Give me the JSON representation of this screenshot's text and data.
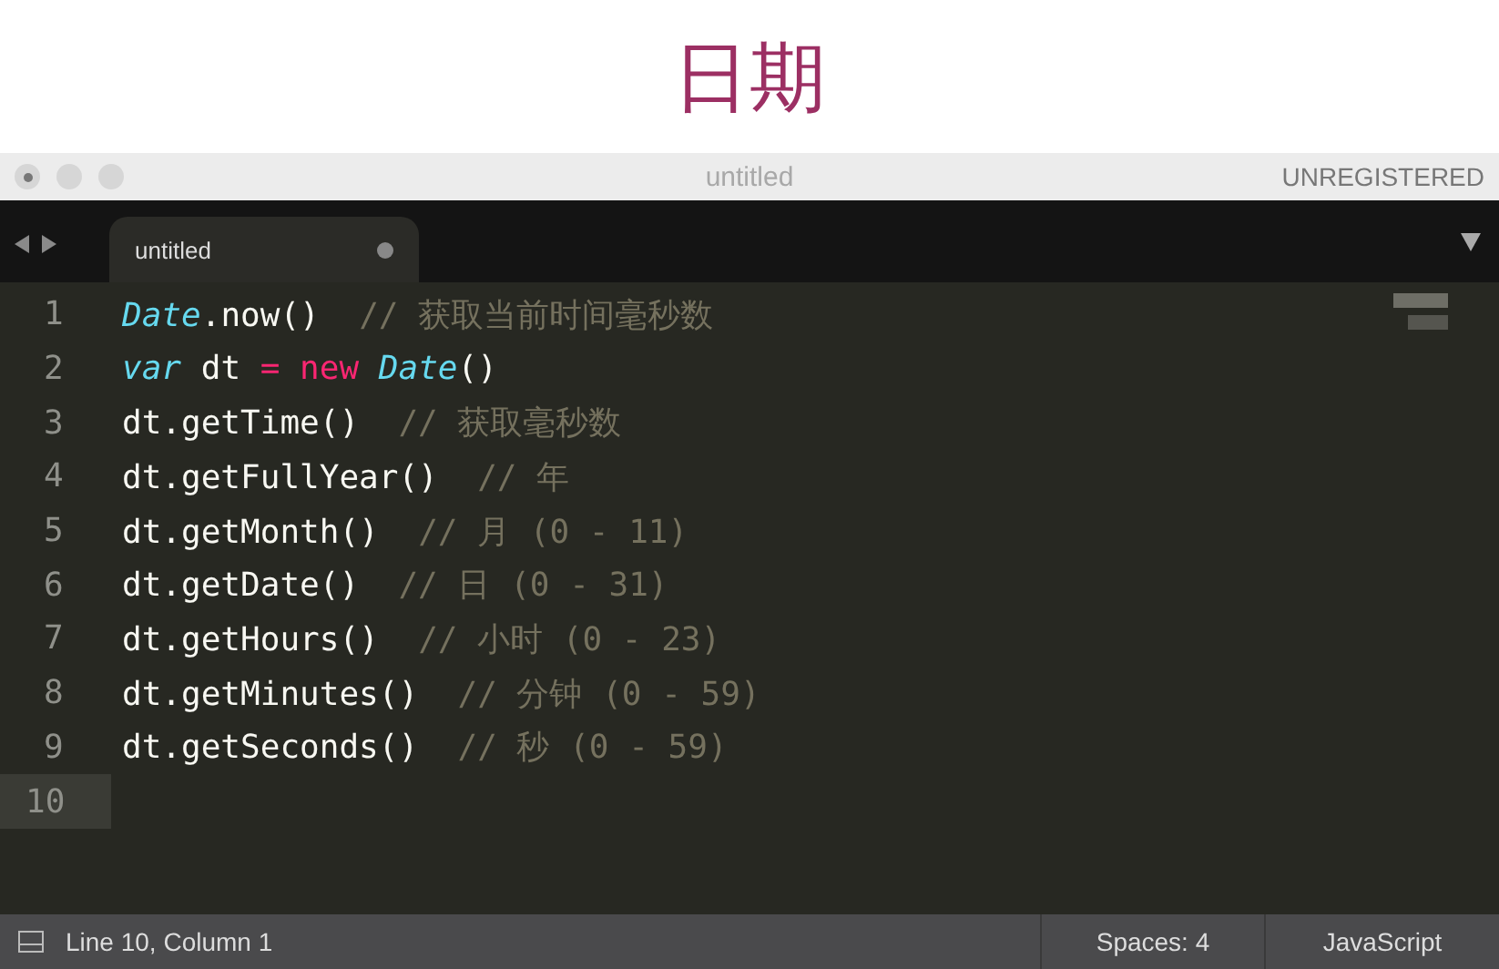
{
  "slide_title": "日期",
  "window": {
    "title": "untitled",
    "license": "UNREGISTERED"
  },
  "tabs": [
    {
      "label": "untitled",
      "selected": true,
      "modified": true
    }
  ],
  "editor": {
    "lines": [
      {
        "number": "1",
        "current": false,
        "tokens": [
          {
            "kind": "class",
            "text": "Date"
          },
          {
            "kind": "plain",
            "text": ".now()  "
          },
          {
            "kind": "comment",
            "text": "// 获取当前时间毫秒数"
          }
        ]
      },
      {
        "number": "2",
        "current": false,
        "tokens": [
          {
            "kind": "keyword",
            "text": "var"
          },
          {
            "kind": "plain",
            "text": " dt "
          },
          {
            "kind": "operator",
            "text": "= new "
          },
          {
            "kind": "class",
            "text": "Date"
          },
          {
            "kind": "plain",
            "text": "()"
          }
        ]
      },
      {
        "number": "3",
        "current": false,
        "tokens": [
          {
            "kind": "plain",
            "text": "dt.getTime()  "
          },
          {
            "kind": "comment",
            "text": "// 获取毫秒数"
          }
        ]
      },
      {
        "number": "4",
        "current": false,
        "tokens": [
          {
            "kind": "plain",
            "text": "dt.getFullYear()  "
          },
          {
            "kind": "comment",
            "text": "// 年"
          }
        ]
      },
      {
        "number": "5",
        "current": false,
        "tokens": [
          {
            "kind": "plain",
            "text": "dt.getMonth()  "
          },
          {
            "kind": "comment",
            "text": "// 月 (0 - 11)"
          }
        ]
      },
      {
        "number": "6",
        "current": false,
        "tokens": [
          {
            "kind": "plain",
            "text": "dt.getDate()  "
          },
          {
            "kind": "comment",
            "text": "// 日 (0 - 31)"
          }
        ]
      },
      {
        "number": "7",
        "current": false,
        "tokens": [
          {
            "kind": "plain",
            "text": "dt.getHours()  "
          },
          {
            "kind": "comment",
            "text": "// 小时 (0 - 23)"
          }
        ]
      },
      {
        "number": "8",
        "current": false,
        "tokens": [
          {
            "kind": "plain",
            "text": "dt.getMinutes()  "
          },
          {
            "kind": "comment",
            "text": "// 分钟 (0 - 59)"
          }
        ]
      },
      {
        "number": "9",
        "current": false,
        "tokens": [
          {
            "kind": "plain",
            "text": "dt.getSeconds()  "
          },
          {
            "kind": "comment",
            "text": "// 秒 (0 - 59)"
          }
        ]
      },
      {
        "number": "10",
        "current": true
      }
    ]
  },
  "status_bar": {
    "position": "Line 10, Column 1",
    "indentation": "Spaces: 4",
    "syntax": "JavaScript"
  }
}
